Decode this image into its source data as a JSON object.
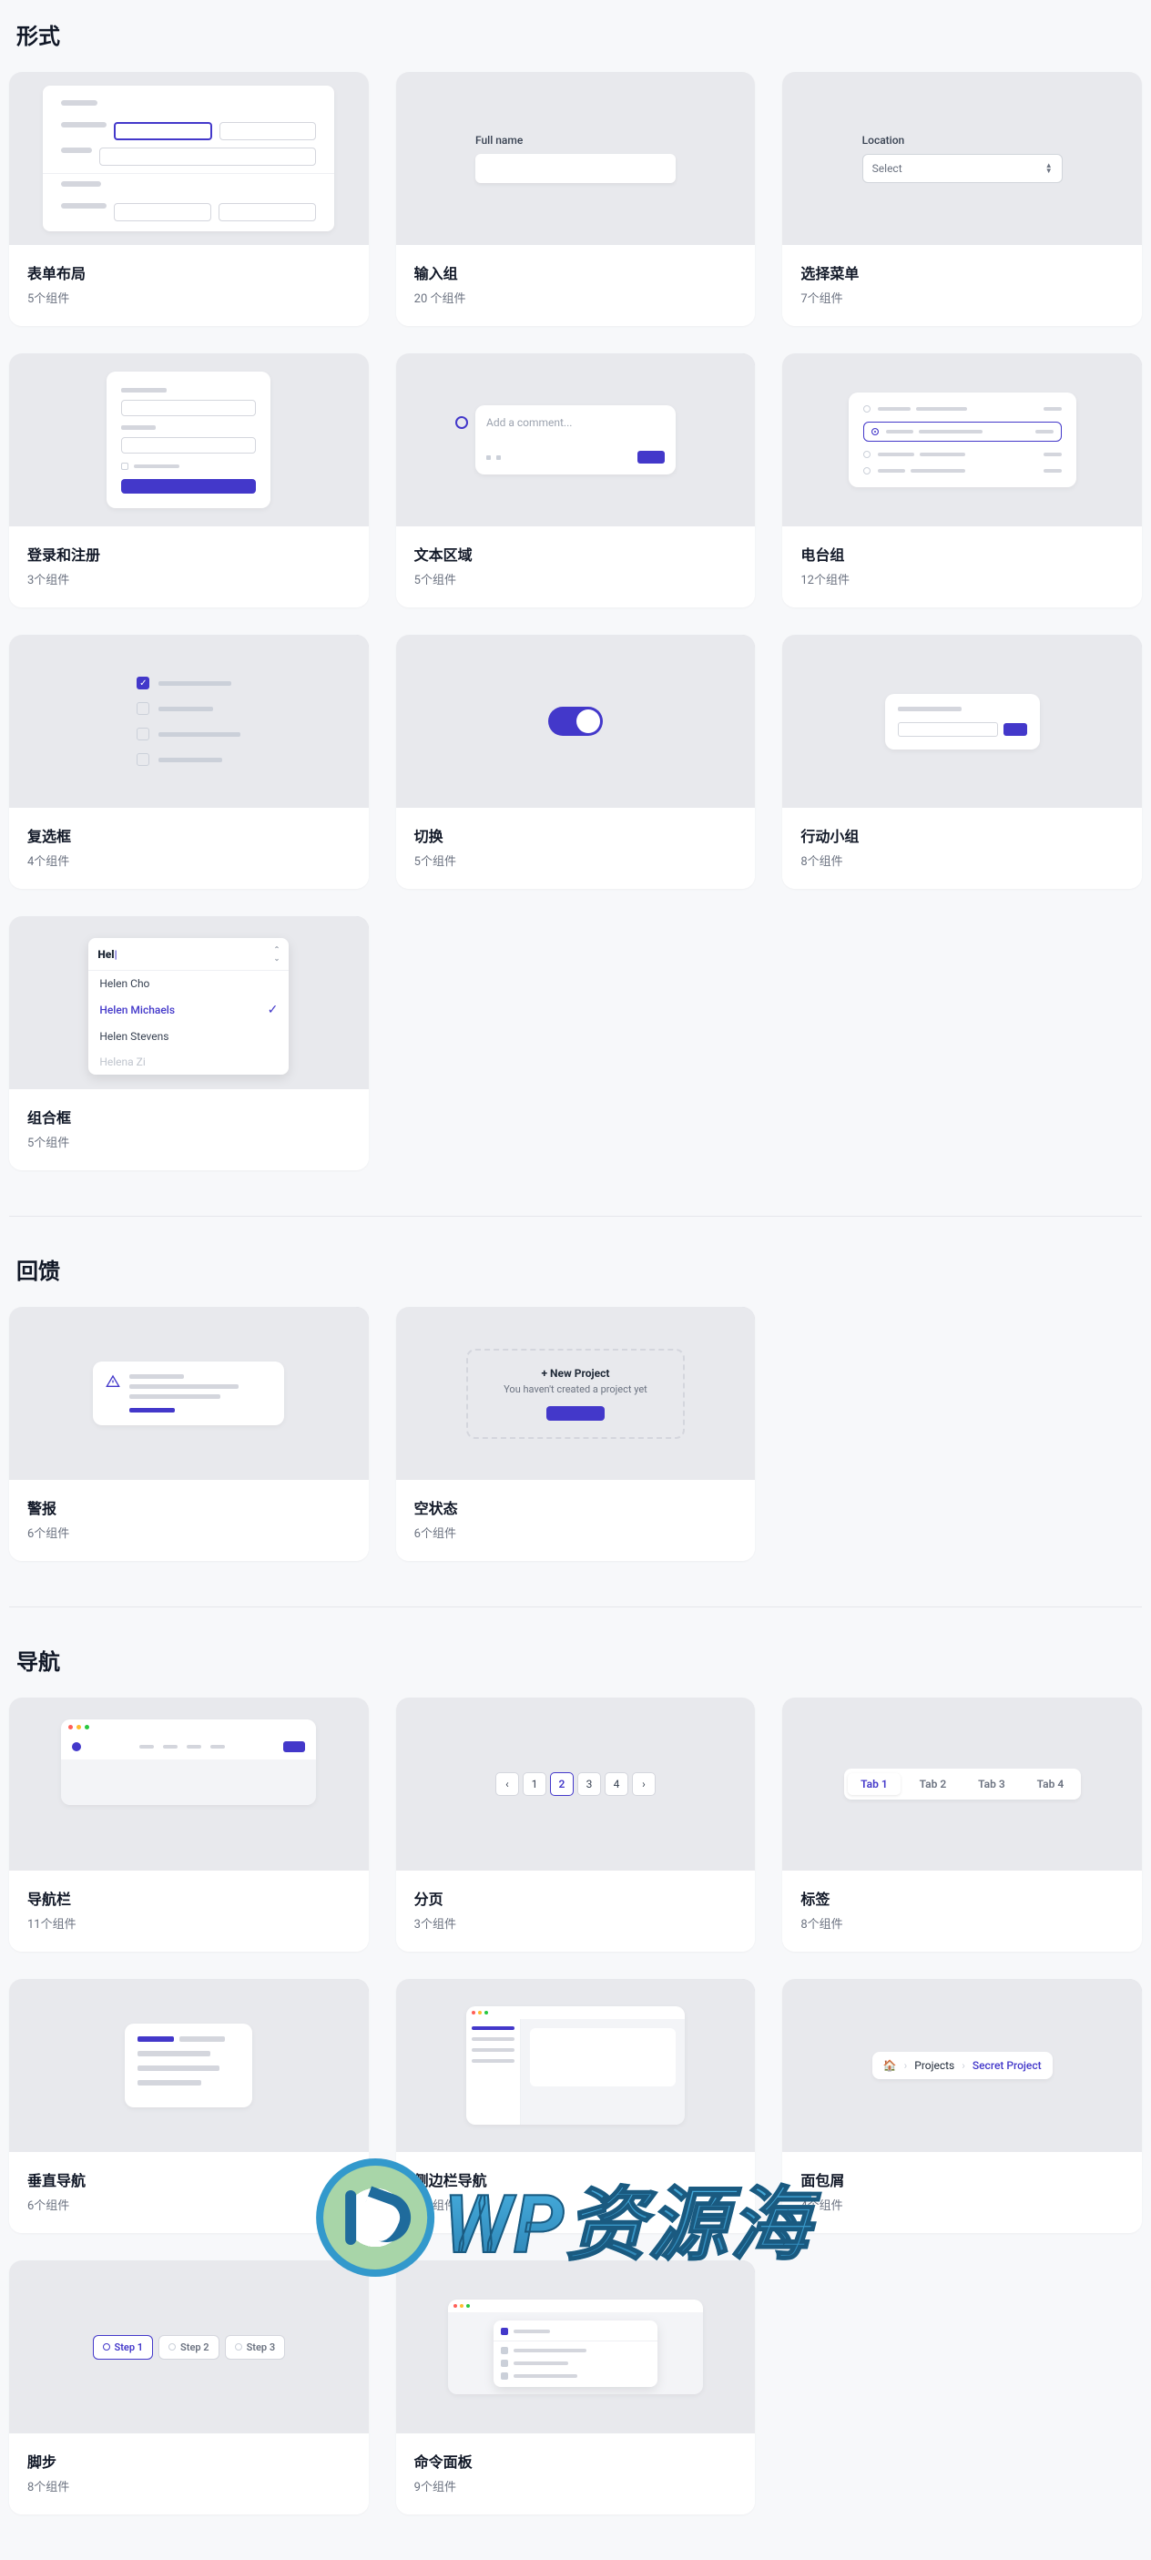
{
  "sections": {
    "forms": {
      "title": "形式"
    },
    "feedback": {
      "title": "回馈"
    },
    "navigation": {
      "title": "导航"
    }
  },
  "cards": {
    "form_layouts": {
      "title": "表单布局",
      "sub": "5个组件"
    },
    "input_groups": {
      "title": "输入组",
      "sub": "20 个组件",
      "label": "Full name"
    },
    "select_menus": {
      "title": "选择菜单",
      "sub": "7个组件",
      "label": "Location",
      "placeholder": "Select"
    },
    "sign_in": {
      "title": "登录和注册",
      "sub": "3个组件"
    },
    "textareas": {
      "title": "文本区域",
      "sub": "5个组件",
      "placeholder": "Add a comment..."
    },
    "radio_groups": {
      "title": "电台组",
      "sub": "12个组件"
    },
    "checkboxes": {
      "title": "复选框",
      "sub": "4个组件"
    },
    "toggles": {
      "title": "切换",
      "sub": "5个组件"
    },
    "action_panels": {
      "title": "行动小组",
      "sub": "8个组件"
    },
    "comboboxes": {
      "title": "组合框",
      "sub": "5个组件",
      "query": "Hel",
      "options": [
        "Helen Cho",
        "Helen Michaels",
        "Helen Stevens",
        "Helena Zi"
      ],
      "selected_index": 1
    },
    "alerts": {
      "title": "警报",
      "sub": "6个组件"
    },
    "empty_states": {
      "title": "空状态",
      "sub": "6个组件",
      "heading": "+ New Project",
      "body": "You haven't created a project yet"
    },
    "navbars": {
      "title": "导航栏",
      "sub": "11个组件"
    },
    "pagination": {
      "title": "分页",
      "sub": "3个组件",
      "pages": [
        "1",
        "2",
        "3",
        "4"
      ],
      "current": "2"
    },
    "tabs": {
      "title": "标签",
      "sub": "8个组件",
      "items": [
        "Tab 1",
        "Tab 2",
        "Tab 3",
        "Tab 4"
      ],
      "active_index": 0
    },
    "vertical_nav": {
      "title": "垂直导航",
      "sub": "6个组件"
    },
    "sidebar_nav": {
      "title": "侧边栏导航",
      "sub": "8个组件"
    },
    "breadcrumbs": {
      "title": "面包屑",
      "sub": "4个组件",
      "items": [
        "Projects",
        "Secret Project"
      ]
    },
    "steps": {
      "title": "脚步",
      "sub": "8个组件",
      "items": [
        "Step 1",
        "Step 2",
        "Step 3"
      ],
      "current_index": 0
    },
    "command": {
      "title": "命令面板",
      "sub": "9个组件"
    }
  },
  "watermark": "WP资源海",
  "colors": {
    "accent": "#4338ca"
  }
}
